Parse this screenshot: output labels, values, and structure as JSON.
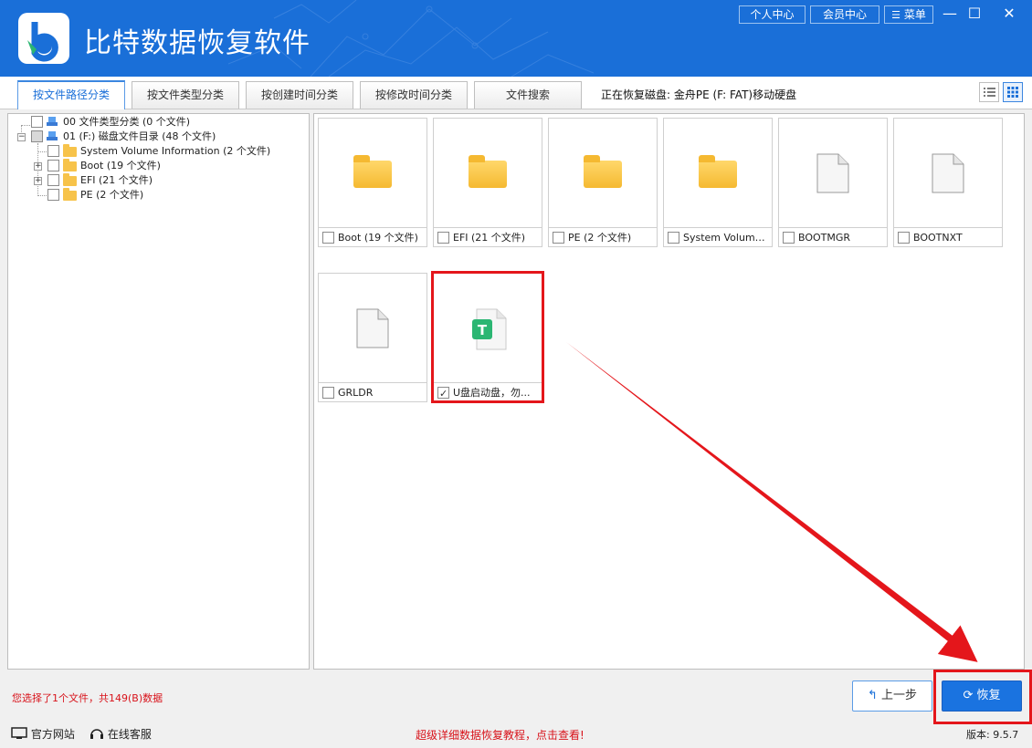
{
  "app": {
    "title": "比特数据恢复软件",
    "top_buttons": {
      "personal": "个人中心",
      "member": "会员中心",
      "menu": "菜单"
    },
    "window_controls": {
      "minimize": "—",
      "maximize": "☐",
      "close": "✕"
    }
  },
  "tabs": [
    {
      "label": "按文件路径分类",
      "active": true
    },
    {
      "label": "按文件类型分类",
      "active": false
    },
    {
      "label": "按创建时间分类",
      "active": false
    },
    {
      "label": "按修改时间分类",
      "active": false
    },
    {
      "label": "文件搜索",
      "active": false
    }
  ],
  "scan_status": "正在恢复磁盘: 金舟PE (F: FAT)移动硬盘",
  "tree": [
    {
      "label": "00 文件类型分类  (0 个文件)",
      "level": 0,
      "icon": "drive-icon"
    },
    {
      "label": "01 (F:) 磁盘文件目录  (48 个文件)",
      "level": 0,
      "icon": "drive-icon",
      "partial": true
    },
    {
      "label": "System Volume Information     (2 个文件)",
      "level": 1,
      "icon": "folder-icon"
    },
    {
      "label": "Boot     (19 个文件)",
      "level": 1,
      "icon": "folder-icon",
      "expandable": true
    },
    {
      "label": "EFI     (21 个文件)",
      "level": 1,
      "icon": "folder-icon",
      "expandable": true
    },
    {
      "label": "PE     (2 个文件)",
      "level": 1,
      "icon": "folder-icon"
    }
  ],
  "files": [
    {
      "name": "Boot  (19 个文件)",
      "type": "folder",
      "checked": false
    },
    {
      "name": "EFI  (21 个文件)",
      "type": "folder",
      "checked": false
    },
    {
      "name": "PE  (2 个文件)",
      "type": "folder",
      "checked": false
    },
    {
      "name": "System Volume In...",
      "type": "folder",
      "checked": false
    },
    {
      "name": "BOOTMGR",
      "type": "file",
      "checked": false
    },
    {
      "name": "BOOTNXT",
      "type": "file",
      "checked": false
    },
    {
      "name": "GRLDR",
      "type": "file",
      "checked": false
    },
    {
      "name": "U盘启动盘，勿...",
      "type": "text",
      "checked": true,
      "badge": "T"
    }
  ],
  "selection_status": "您选择了1个文件，共149(B)数据",
  "buttons": {
    "prev": "上一步",
    "recover": "恢复"
  },
  "footer": {
    "website": "官方网站",
    "support": "在线客服",
    "tutorial": "超级详细数据恢复教程，点击查看!",
    "version": "版本: 9.5.7"
  },
  "colors": {
    "brand": "#1a6fd8",
    "highlight": "#e4161b",
    "text_badge": "#2bb673"
  }
}
